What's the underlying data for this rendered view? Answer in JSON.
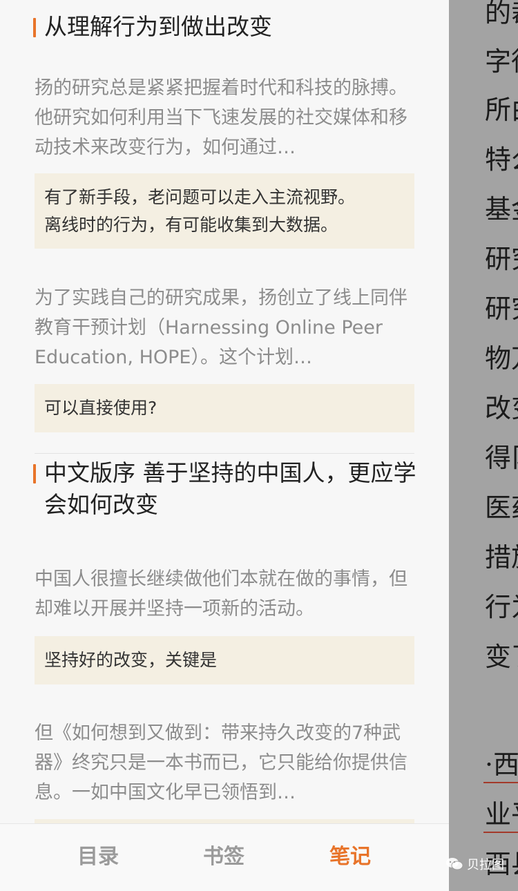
{
  "notes": [
    {
      "chapter_title": "从理解行为到做出改变",
      "entries": [
        {
          "excerpt": "扬的研究总是紧紧把握着时代和科技的脉搏。他研究如何利用当下飞速发展的社交媒体和移动技术来改变行为，如何通过…",
          "note_lines": [
            "有了新手段，老问题可以走入主流视野。",
            "离线时的行为，有可能收集到大数据。"
          ]
        },
        {
          "excerpt": "为了实践自己的研究成果，扬创立了线上同伴教育干预计划（Harnessing Online Peer Education, HOPE）。这个计划…",
          "note_lines": [
            "可以直接使用?"
          ]
        }
      ]
    },
    {
      "chapter_title": "中文版序 善于坚持的中国人，更应学会如何改变",
      "entries": [
        {
          "excerpt": "中国人很擅长继续做他们本就在做的事情，但却难以开展并坚持一项新的活动。",
          "note_lines": [
            "坚持好的改变，关键是"
          ]
        },
        {
          "excerpt": "但《如何想到又做到：带来持久改变的7种武器》终究只是一本书而已，它只能给你提供信息。一如中国文化早已领悟到…",
          "note_lines": []
        }
      ]
    }
  ],
  "tabs": [
    {
      "label": "目录",
      "active": false
    },
    {
      "label": "书签",
      "active": false
    },
    {
      "label": "笔记",
      "active": true
    }
  ],
  "background_page_lines": [
    "的裁",
    "字徒",
    "所由",
    "特么",
    "基金",
    "研究",
    "研究",
    "物万",
    "改变",
    "得阝",
    "医药",
    "措旅",
    "行为",
    "变了",
    "·西",
    "业平",
    "西县"
  ],
  "watermark": {
    "text": "贝拉图"
  },
  "colors": {
    "accent": "#e8742a",
    "note_bg": "#f4efe2",
    "panel_bg": "#f7f7f7"
  }
}
